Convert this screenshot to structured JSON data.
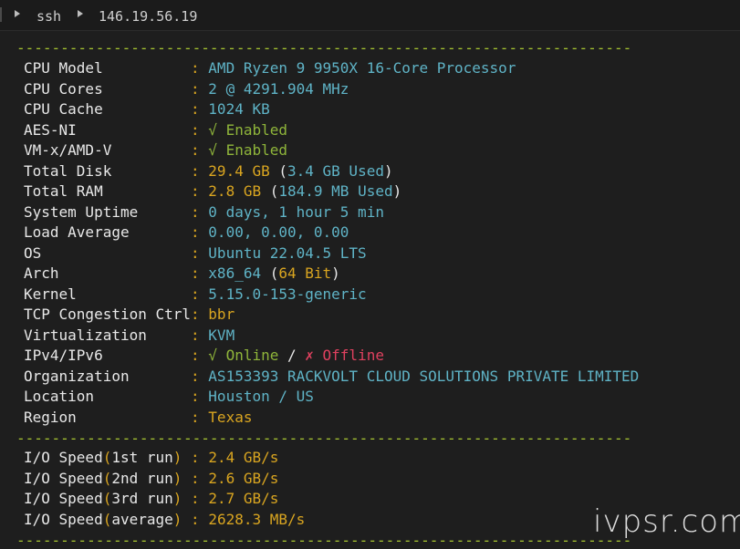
{
  "titlebar": {
    "crumbs": [
      "ssh",
      "146.19.56.19"
    ]
  },
  "divider": "----------------------------------------------------------------------",
  "system_info": [
    {
      "label": "CPU Model",
      "value": [
        {
          "t": "AMD Ryzen 9 9950X 16-Core Processor",
          "c": "cyan"
        }
      ]
    },
    {
      "label": "CPU Cores",
      "value": [
        {
          "t": "2 @ 4291.904 MHz",
          "c": "cyan"
        }
      ]
    },
    {
      "label": "CPU Cache",
      "value": [
        {
          "t": "1024 KB",
          "c": "cyan"
        }
      ]
    },
    {
      "label": "AES-NI",
      "value": [
        {
          "t": "√ Enabled",
          "c": "green"
        }
      ]
    },
    {
      "label": "VM-x/AMD-V",
      "value": [
        {
          "t": "√ Enabled",
          "c": "green"
        }
      ]
    },
    {
      "label": "Total Disk",
      "value": [
        {
          "t": "29.4 GB ",
          "c": "yellow"
        },
        {
          "t": "(",
          "c": "white"
        },
        {
          "t": "3.4 GB Used",
          "c": "cyan"
        },
        {
          "t": ")",
          "c": "white"
        }
      ]
    },
    {
      "label": "Total RAM",
      "value": [
        {
          "t": "2.8 GB ",
          "c": "yellow"
        },
        {
          "t": "(",
          "c": "white"
        },
        {
          "t": "184.9 MB Used",
          "c": "cyan"
        },
        {
          "t": ")",
          "c": "white"
        }
      ]
    },
    {
      "label": "System Uptime",
      "value": [
        {
          "t": "0 days, 1 hour 5 min",
          "c": "cyan"
        }
      ]
    },
    {
      "label": "Load Average",
      "value": [
        {
          "t": "0.00, 0.00, 0.00",
          "c": "cyan"
        }
      ]
    },
    {
      "label": "OS",
      "value": [
        {
          "t": "Ubuntu 22.04.5 LTS",
          "c": "cyan"
        }
      ]
    },
    {
      "label": "Arch",
      "value": [
        {
          "t": "x86_64 ",
          "c": "cyan"
        },
        {
          "t": "(",
          "c": "white"
        },
        {
          "t": "64 Bit",
          "c": "yellow"
        },
        {
          "t": ")",
          "c": "white"
        }
      ]
    },
    {
      "label": "Kernel",
      "value": [
        {
          "t": "5.15.0-153-generic",
          "c": "cyan"
        }
      ]
    },
    {
      "label": "TCP Congestion Ctrl",
      "value": [
        {
          "t": "bbr",
          "c": "yellow"
        }
      ]
    },
    {
      "label": "Virtualization",
      "value": [
        {
          "t": "KVM",
          "c": "cyan"
        }
      ]
    },
    {
      "label": "IPv4/IPv6",
      "value": [
        {
          "t": "√ Online",
          "c": "green"
        },
        {
          "t": " / ",
          "c": "white"
        },
        {
          "t": "✗ Offline",
          "c": "red"
        }
      ]
    },
    {
      "label": "Organization",
      "value": [
        {
          "t": "AS153393 RACKVOLT CLOUD SOLUTIONS PRIVATE LIMITED",
          "c": "cyan"
        }
      ]
    },
    {
      "label": "Location",
      "value": [
        {
          "t": "Houston / US",
          "c": "cyan"
        }
      ]
    },
    {
      "label": "Region",
      "value": [
        {
          "t": "Texas",
          "c": "yellow"
        }
      ]
    }
  ],
  "io_speed": [
    {
      "label": "1st run",
      "value": "2.4 GB/s"
    },
    {
      "label": "2nd run",
      "value": "2.6 GB/s"
    },
    {
      "label": "3rd run",
      "value": "2.7 GB/s"
    },
    {
      "label": "average",
      "value": "2628.3 MB/s"
    }
  ],
  "io_prefix": "I/O Speed",
  "watermark": "ivpsr.com",
  "colors": {
    "background": "#1e1e1e",
    "cyan": "#5fb3c6",
    "green": "#8fb53a",
    "yellow": "#d9a520",
    "red": "#e0415f"
  }
}
